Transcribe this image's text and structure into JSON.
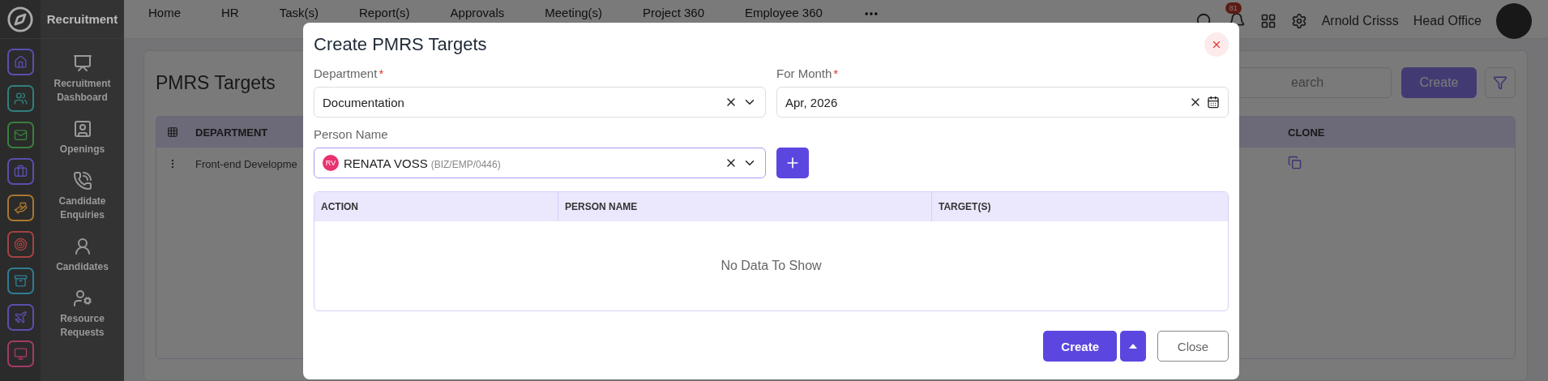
{
  "app": {
    "title": "Recruitment"
  },
  "icon_rail": [
    {
      "color": "#5a4fae"
    },
    {
      "color": "#2f807c"
    },
    {
      "color": "#3a7f3e"
    },
    {
      "color": "#5a4fae"
    },
    {
      "color": "#a8772e"
    },
    {
      "color": "#a34242"
    },
    {
      "color": "#2f7d93"
    },
    {
      "color": "#5a4fae"
    },
    {
      "color": "#a33b66"
    }
  ],
  "module_menu": [
    {
      "label": "Recruitment Dashboard"
    },
    {
      "label": "Openings"
    },
    {
      "label": "Candidate Enquiries"
    },
    {
      "label": "Candidates"
    },
    {
      "label": "Resource Requests"
    }
  ],
  "top_nav": [
    "Home",
    "HR",
    "Task(s)",
    "Report(s)",
    "Approvals",
    "Meeting(s)",
    "Project 360",
    "Employee 360"
  ],
  "header": {
    "notifications": "81",
    "user": "Arnold Crisss",
    "branch": "Head Office"
  },
  "page": {
    "title": "PMRS Targets",
    "search": {
      "placeholder": "earch"
    },
    "create_button": "Create",
    "table": {
      "columns": [
        "DEPARTMENT",
        "CLONE"
      ],
      "rows": [
        {
          "department": "Front-end Developme"
        }
      ]
    }
  },
  "dialog": {
    "title": "Create PMRS Targets",
    "required_mark": "*",
    "fields": [
      {
        "label": "Department",
        "required": true,
        "value": "Documentation",
        "kind": "select"
      },
      {
        "label": "For Month",
        "required": true,
        "value": "Apr, 2026",
        "kind": "date"
      }
    ],
    "person": {
      "label": "Person Name",
      "initials": "RV",
      "name": "RENATA VOSS",
      "code": "(BIZ/EMP/0446)"
    },
    "table": {
      "columns": [
        "ACTION",
        "PERSON NAME",
        "TARGET(S)"
      ],
      "empty": "No Data To Show"
    },
    "buttons": {
      "create": "Create",
      "close": "Close"
    }
  }
}
